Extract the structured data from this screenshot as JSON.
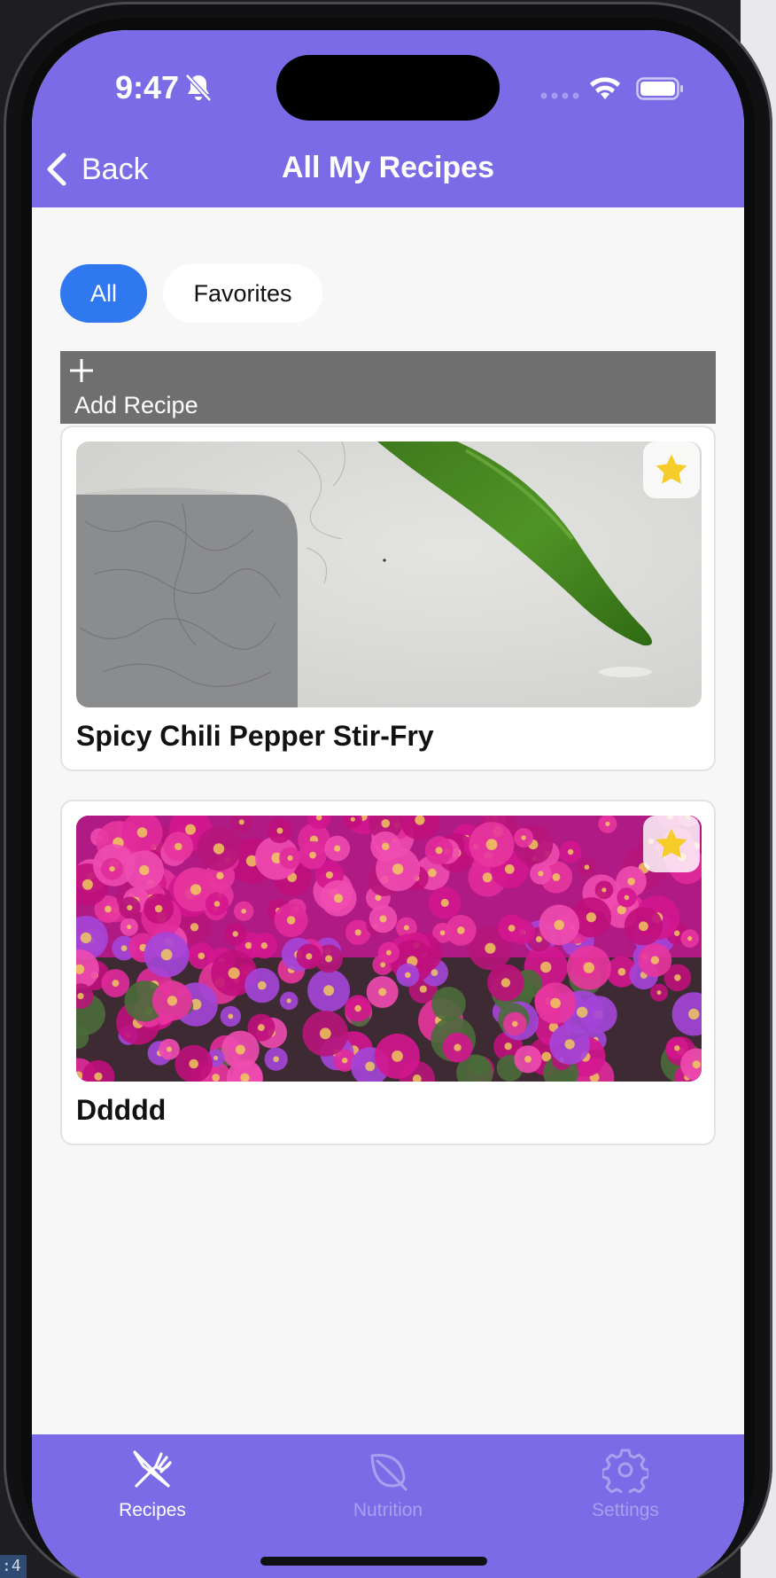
{
  "status_bar": {
    "time": "9:47"
  },
  "nav": {
    "back_label": "Back",
    "title": "All My Recipes"
  },
  "filters": {
    "all_label": "All",
    "favorites_label": "Favorites",
    "selected": "All"
  },
  "add_recipe": {
    "label": "Add Recipe"
  },
  "recipes": [
    {
      "title": "Spicy Chili Pepper Stir-Fry",
      "favorite": true,
      "photo": "green-chili-pepper-on-counter"
    },
    {
      "title": "Ddddd",
      "favorite": true,
      "photo": "magenta-flower-field"
    }
  ],
  "tabbar": {
    "tabs": [
      {
        "label": "Recipes",
        "icon": "fork-knife-icon",
        "active": true
      },
      {
        "label": "Nutrition",
        "icon": "leaf-icon",
        "active": false
      },
      {
        "label": "Settings",
        "icon": "gear-icon",
        "active": false
      }
    ]
  },
  "colors": {
    "header": "#7b6be6",
    "chip_selected": "#2f78f0",
    "add_bar": "#6f6f6f",
    "star": "#f5cc2a"
  }
}
